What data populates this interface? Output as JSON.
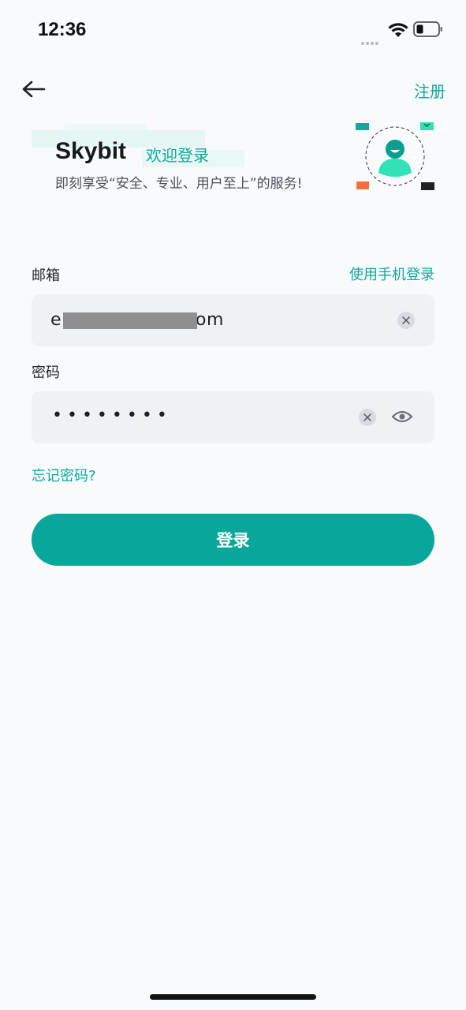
{
  "status": {
    "time": "12:36"
  },
  "nav": {
    "register_label": "注册"
  },
  "hero": {
    "brand": "Skybit",
    "welcome": "欢迎登录",
    "tagline": "即刻享受“安全、专业、用户至上”的服务!"
  },
  "form": {
    "email_label": "邮箱",
    "phone_login_label": "使用手机登录",
    "email_value": "e                    .com",
    "password_label": "密码",
    "password_value": "••••••••",
    "forgot_label": "忘记密码?",
    "login_label": "登录"
  },
  "colors": {
    "accent": "#08a79c",
    "link": "#0ea89b",
    "field_bg": "#eff1f5",
    "page_bg": "#f8fafc"
  },
  "icons": [
    "back-arrow-icon",
    "wifi-icon",
    "battery-icon",
    "clear-icon",
    "eye-icon",
    "avatar-illustration"
  ]
}
